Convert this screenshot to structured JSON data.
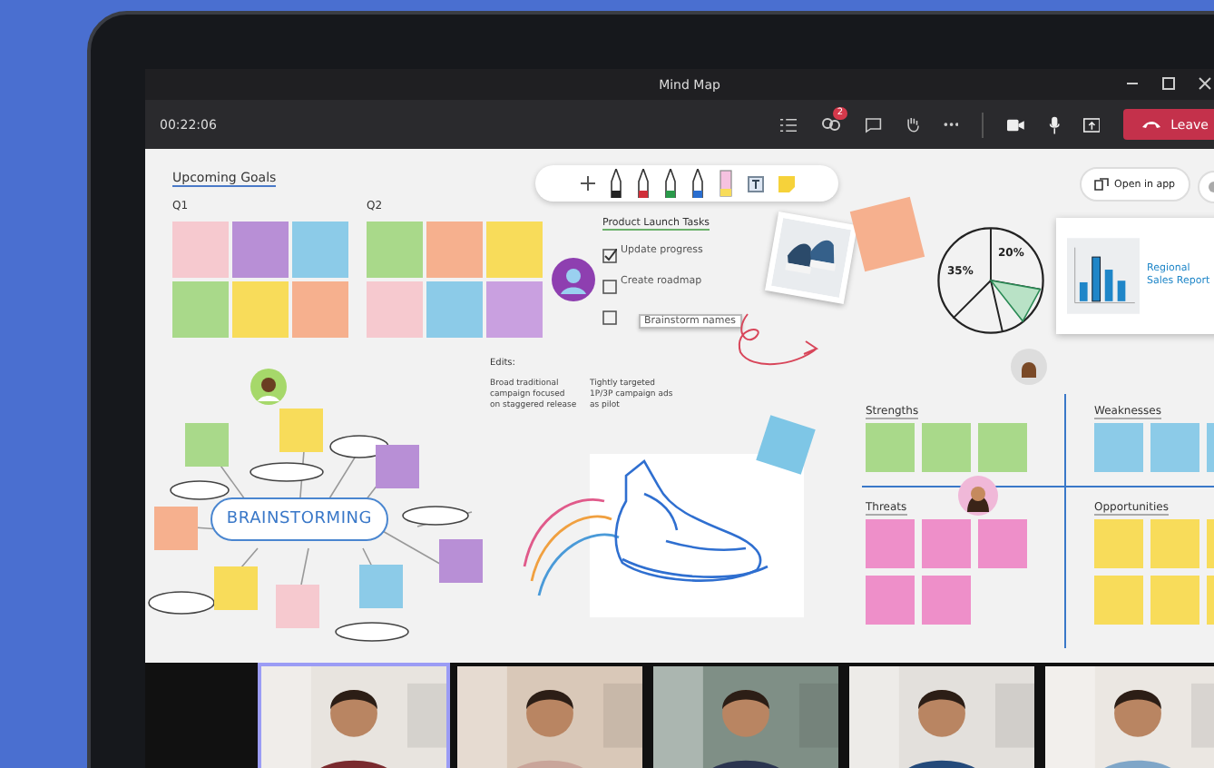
{
  "window": {
    "title": "Mind Map"
  },
  "meeting_bar": {
    "timer": "00:22:06",
    "people_badge": "2",
    "leave_button": "Leave"
  },
  "whiteboard": {
    "open_in_app": "Open in app",
    "pens": [
      {
        "color": "#222222"
      },
      {
        "color": "#d0303a"
      },
      {
        "color": "#2a9a4a"
      },
      {
        "color": "#2a6ed0"
      }
    ],
    "goals": {
      "title": "Upcoming Goals",
      "quarters": [
        {
          "label": "Q1",
          "notes": [
            {
              "color": "#f6c9cf"
            },
            {
              "color": "#b88fd6"
            },
            {
              "color": "#8ccbe8"
            },
            {
              "color": "#a9d98a"
            },
            {
              "color": "#f8dc5a"
            },
            {
              "color": "#f6b08e"
            }
          ]
        },
        {
          "label": "Q2",
          "notes": [
            {
              "color": "#a9d98a"
            },
            {
              "color": "#f6b08e"
            },
            {
              "color": "#f8dc5a"
            },
            {
              "color": "#f6c9cf"
            },
            {
              "color": "#8ccbe8"
            },
            {
              "color": "#c9a0e0"
            }
          ]
        }
      ]
    },
    "tasks": {
      "title": "Product Launch Tasks",
      "items": [
        {
          "label": "Update progress",
          "checked": true
        },
        {
          "label": "Create roadmap",
          "checked": false
        },
        {
          "label": "Brainstorm names",
          "checked": false
        }
      ]
    },
    "edits": {
      "title": "Edits:",
      "items": [
        "Broad traditional campaign focused on staggered release",
        "Tightly targeted 1P/3P campaign ads as pilot"
      ]
    },
    "pie_labels": [
      "35%",
      "20%"
    ],
    "report": {
      "title": "Regional Sales Report"
    },
    "brainstorm": {
      "title": "BRAINSTORMING",
      "notes": [
        {
          "color": "#a9d98a"
        },
        {
          "color": "#f8dc5a"
        },
        {
          "color": "#b88fd6"
        },
        {
          "color": "#f6b08e"
        },
        {
          "color": "#f8dc5a"
        },
        {
          "color": "#f6c9cf"
        },
        {
          "color": "#8ccbe8"
        },
        {
          "color": "#b88fd6"
        }
      ]
    },
    "swot": [
      {
        "label": "Strengths",
        "notes": [
          {
            "color": "#a9d98a"
          },
          {
            "color": "#a9d98a"
          },
          {
            "color": "#a9d98a"
          }
        ]
      },
      {
        "label": "Weaknesses",
        "notes": [
          {
            "color": "#8ccbe8"
          },
          {
            "color": "#8ccbe8"
          },
          {
            "color": "#8ccbe8"
          }
        ]
      },
      {
        "label": "Threats",
        "notes": [
          {
            "color": "#ee8fc9"
          },
          {
            "color": "#ee8fc9"
          },
          {
            "color": "#ee8fc9"
          },
          {
            "color": "#ee8fc9"
          },
          {
            "color": "#ee8fc9"
          }
        ]
      },
      {
        "label": "Opportunities",
        "notes": [
          {
            "color": "#f8dc5a"
          },
          {
            "color": "#f8dc5a"
          },
          {
            "color": "#f8dc5a"
          },
          {
            "color": "#f8dc5a"
          },
          {
            "color": "#f8dc5a"
          },
          {
            "color": "#f8dc5a"
          }
        ]
      }
    ]
  },
  "video_tiles": [
    {
      "selected": true
    },
    {
      "selected": false
    },
    {
      "selected": false
    },
    {
      "selected": false
    },
    {
      "selected": false
    }
  ]
}
